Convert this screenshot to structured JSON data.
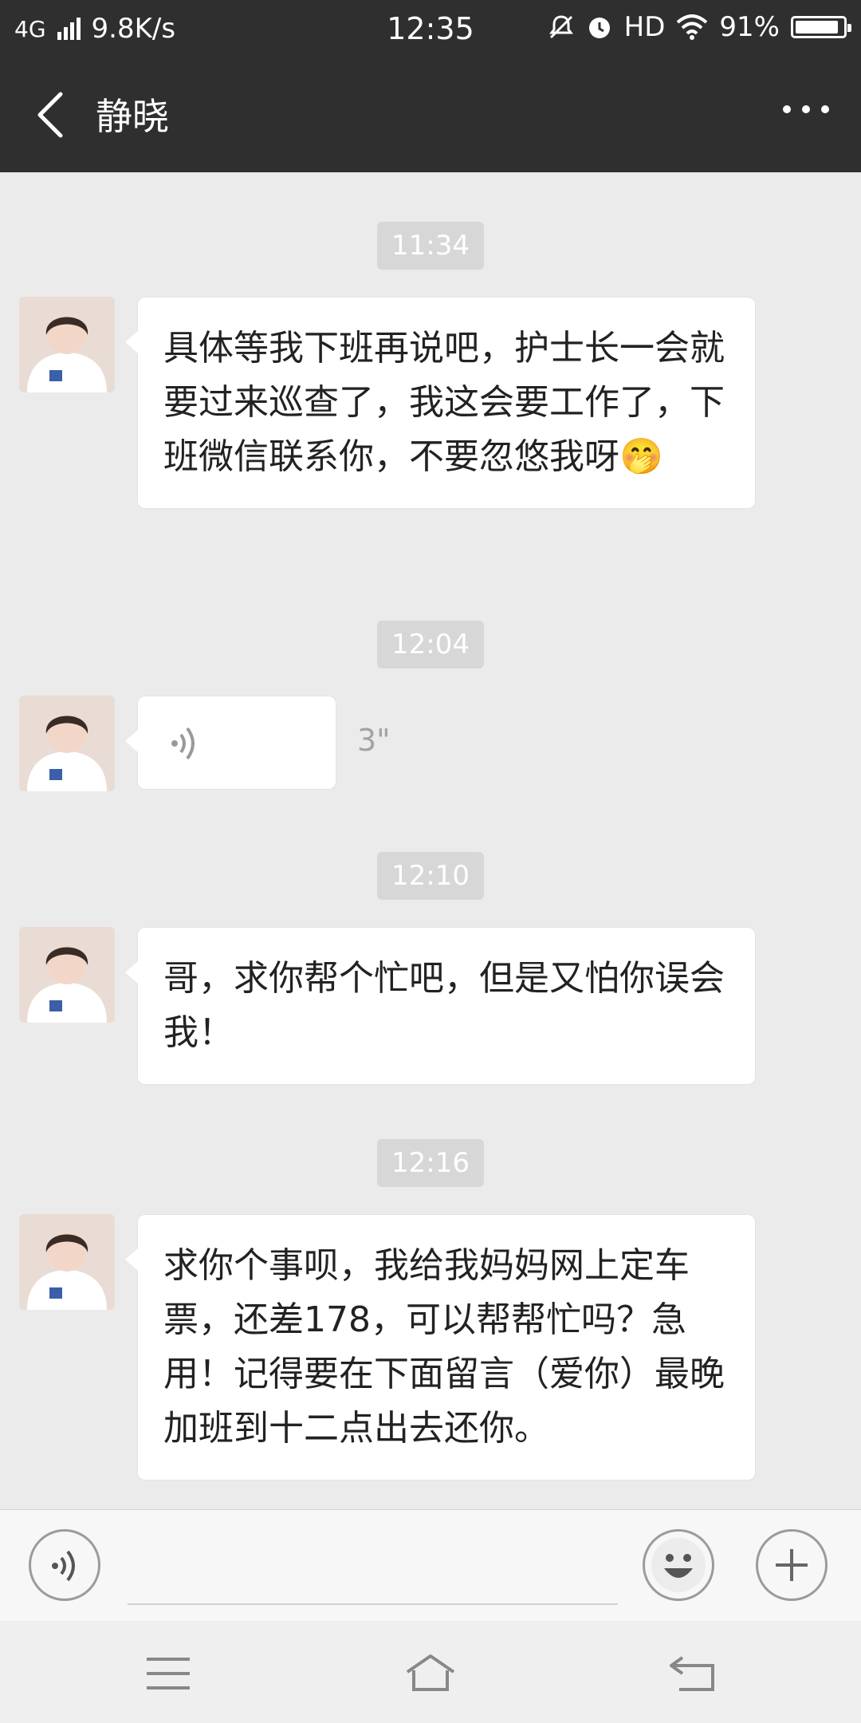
{
  "status": {
    "network": "4G",
    "speed": "9.8K/s",
    "time": "12:35",
    "hd": "HD",
    "battery": "91%",
    "battery_level": 0.91
  },
  "header": {
    "contact_name": "静晓",
    "back_icon": "chevron-left-icon",
    "more_icon": "more-dots-icon"
  },
  "messages": [
    {
      "time": "11:34",
      "type": "text",
      "text": "具体等我下班再说吧，护士长一会就要过来巡查了，我这会要工作了，下班微信联系你，不要忽悠我呀",
      "emoji": "🤭"
    },
    {
      "time": "12:04",
      "type": "voice",
      "duration": "3\""
    },
    {
      "time": "12:10",
      "type": "text",
      "text": "哥，求你帮个忙吧，但是又怕你误会我！"
    },
    {
      "time": "12:16",
      "type": "text",
      "text": "求你个事呗，我给我妈妈网上定车票，还差178，可以帮帮忙吗？急用！记得要在下面留言（爱你）最晚加班到十二点出去还你。"
    }
  ],
  "input": {
    "voice_icon": "voice-icon",
    "emoji_icon": "emoji-icon",
    "plus_icon": "plus-icon"
  },
  "navigation": {
    "menu_icon": "menu-icon",
    "home_icon": "home-icon",
    "back_icon": "back-arrow-icon"
  }
}
